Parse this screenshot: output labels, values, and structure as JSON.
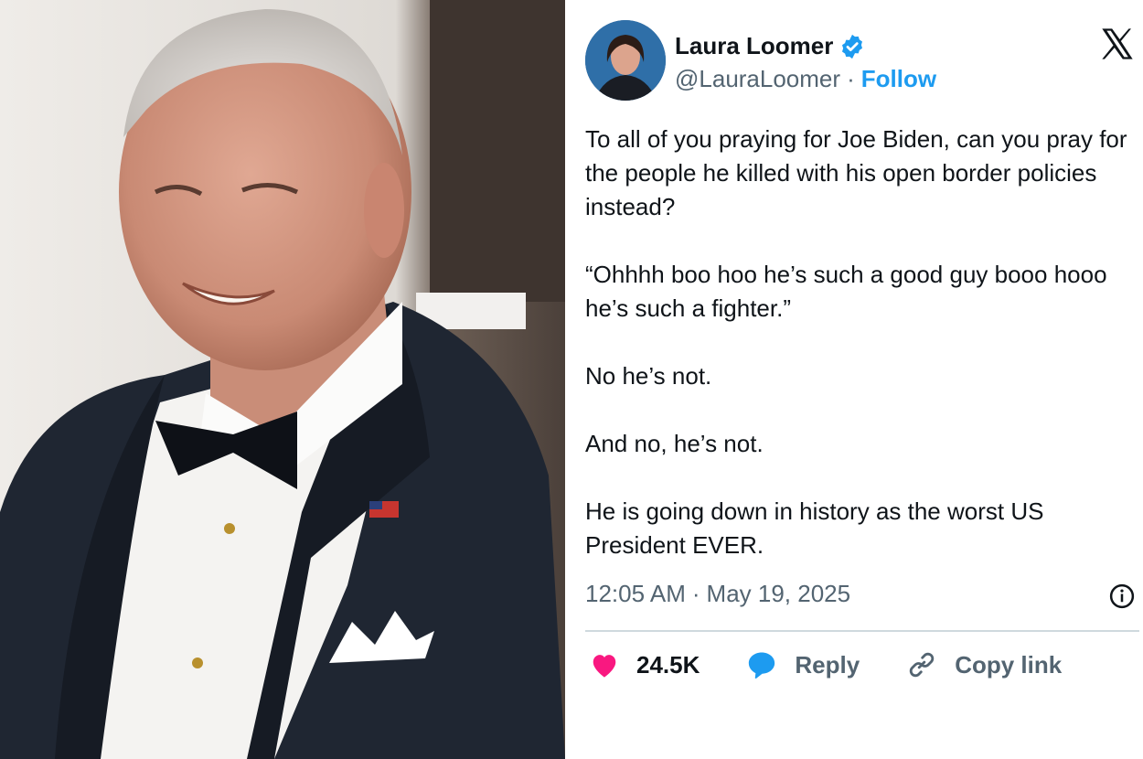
{
  "tweet": {
    "author_name": "Laura Loomer",
    "handle": "@LauraLoomer",
    "separator": "·",
    "follow_label": "Follow",
    "paragraphs": [
      "To all of you praying for Joe Biden, can you pray for the people he killed with his open border policies instead?",
      "“Ohhhh boo hoo he’s such a good guy booo hooo he’s such a fighter.”",
      "No he’s not.",
      "And no, he’s not.",
      "He is going down in history as the worst US President EVER."
    ],
    "time": "12:05 AM",
    "date": "May 19, 2025",
    "likes": "24.5K",
    "reply_label": "Reply",
    "copy_link_label": "Copy link"
  },
  "colors": {
    "accent": "#1d9bf0",
    "like": "#f91880",
    "muted": "#536471",
    "text": "#0f1419"
  },
  "icons": [
    "verified-badge-icon",
    "x-logo-icon",
    "info-icon",
    "heart-icon",
    "reply-icon",
    "link-icon"
  ]
}
